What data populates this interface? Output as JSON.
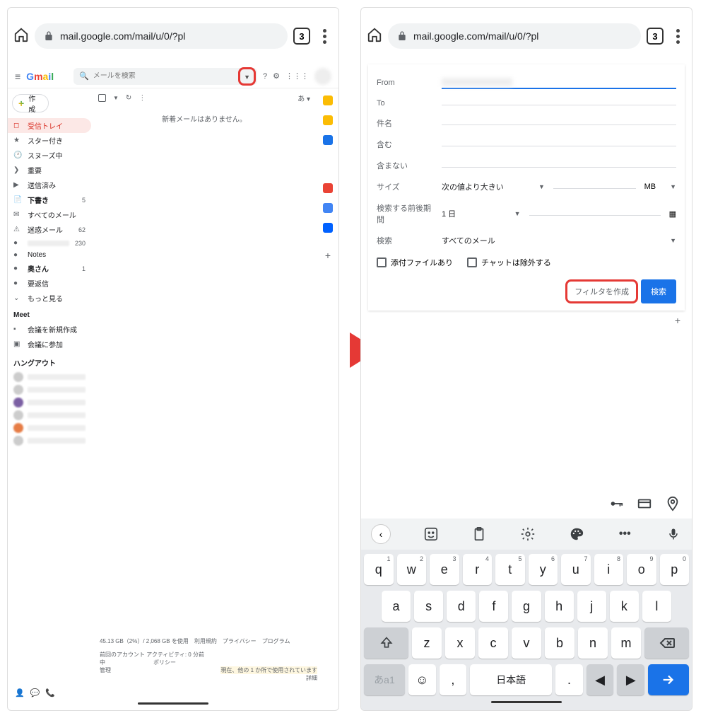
{
  "browser": {
    "url": "mail.google.com/mail/u/0/?pl",
    "tab_count": "3"
  },
  "left": {
    "app_name": "Gmail",
    "search_placeholder": "メールを検索",
    "compose": "作成",
    "nav": {
      "inbox": "受信トレイ",
      "starred": "スター付き",
      "snoozed": "スヌーズ中",
      "important": "重要",
      "sent": "送信済み",
      "drafts": "下書き",
      "drafts_count": "5",
      "all_mail": "すべてのメール",
      "spam": "迷惑メール",
      "spam_count": "62",
      "label1_count": "230",
      "notes": "Notes",
      "okusan": "奥さん",
      "okusan_count": "1",
      "reply_needed": "要返信",
      "more": "もっと見る"
    },
    "meet": {
      "header": "Meet",
      "new": "会議を新規作成",
      "join": "会議に参加"
    },
    "hangouts": "ハングアウト",
    "toolbar_lang": "あ ▾",
    "empty": "新着メールはありません。",
    "footer": {
      "storage": "45.13 GB（2%）/ 2,068 GB を使用",
      "terms": "利用規約",
      "privacy": "プライバシー",
      "program": "プログラム",
      "policy": "ポリシー",
      "activity": "前回のアカウント アクティビティ: 0 分前",
      "in_use": "中",
      "manage": "管理",
      "open_elsewhere": "現在、他の 1 か所で使用されています",
      "details": "詳細"
    }
  },
  "right": {
    "form": {
      "from": "From",
      "to": "To",
      "subject": "件名",
      "has_words": "含む",
      "not_have": "含まない",
      "size": "サイズ",
      "size_op": "次の値より大きい",
      "size_unit": "MB",
      "date_within": "検索する前後期間",
      "date_value": "1 日",
      "search_in": "検索",
      "search_target": "すべてのメール",
      "has_attachment": "添付ファイルあり",
      "exclude_chat": "チャットは除外する",
      "create_filter": "フィルタを作成",
      "search_btn": "検索"
    },
    "keyboard": {
      "row1": [
        {
          "k": "q",
          "s": "1"
        },
        {
          "k": "w",
          "s": "2"
        },
        {
          "k": "e",
          "s": "3"
        },
        {
          "k": "r",
          "s": "4"
        },
        {
          "k": "t",
          "s": "5"
        },
        {
          "k": "y",
          "s": "6"
        },
        {
          "k": "u",
          "s": "7"
        },
        {
          "k": "i",
          "s": "8"
        },
        {
          "k": "o",
          "s": "9"
        },
        {
          "k": "p",
          "s": "0"
        }
      ],
      "row2": [
        "a",
        "s",
        "d",
        "f",
        "g",
        "h",
        "j",
        "k",
        "l"
      ],
      "row3": [
        "z",
        "x",
        "c",
        "v",
        "b",
        "n",
        "m"
      ],
      "lang_key": "あa1",
      "space": "日本語",
      "comma": ",",
      "period": "."
    }
  }
}
